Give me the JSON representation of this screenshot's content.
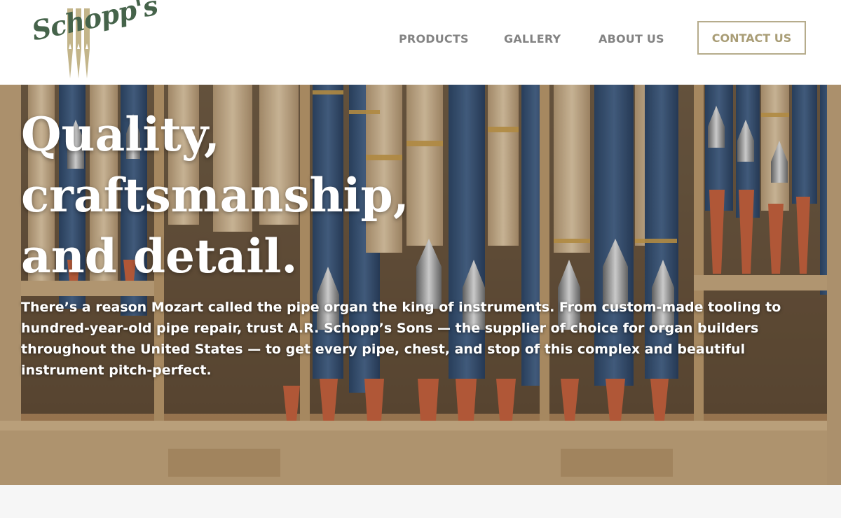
{
  "brand": {
    "logo_text": "Schopp's",
    "colors": {
      "logo_green": "#45634a",
      "logo_gold": "#c3b58a",
      "accent": "#b6ac8c"
    }
  },
  "nav": {
    "products": "PRODUCTS",
    "gallery": "GALLERY",
    "about": "ABOUT US",
    "contact": "CONTACT US"
  },
  "hero": {
    "title_lines": [
      "Quality,",
      "craftsmanship,",
      "and detail."
    ],
    "body": "There’s a reason Mozart called the pipe organ the king of instruments. From custom-made tooling to hundred-year-old pipe repair, trust A.R. Schopp’s Sons — the supplier of choice for organ builders throughout the United States — to get every pipe, chest, and stop of this complex and beautiful instrument pitch-perfect."
  }
}
